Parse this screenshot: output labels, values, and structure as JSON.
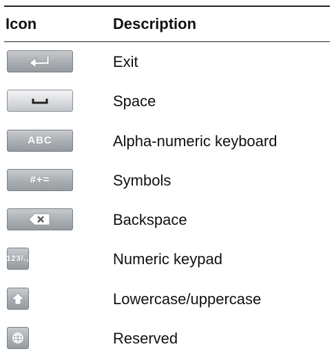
{
  "table": {
    "header": {
      "icon_col": "Icon",
      "desc_col": "Description"
    },
    "rows": [
      {
        "icon": "enter-arrow-icon",
        "key_text": "",
        "description": "Exit"
      },
      {
        "icon": "space-bar-icon",
        "key_text": "",
        "description": "Space"
      },
      {
        "icon": "abc-key-icon",
        "key_text": "ABC",
        "description": "Alpha-numeric keyboard"
      },
      {
        "icon": "symbols-key-icon",
        "key_text": "#+=",
        "description": "Symbols"
      },
      {
        "icon": "backspace-icon",
        "key_text": "",
        "description": "Backspace"
      },
      {
        "icon": "numeric-keypad-icon",
        "key_text": "123/.,",
        "description": "Numeric keypad"
      },
      {
        "icon": "shift-up-arrow-icon",
        "key_text": "",
        "description": "Lowercase/uppercase"
      },
      {
        "icon": "globe-icon",
        "key_text": "",
        "description": "Reserved"
      }
    ]
  }
}
